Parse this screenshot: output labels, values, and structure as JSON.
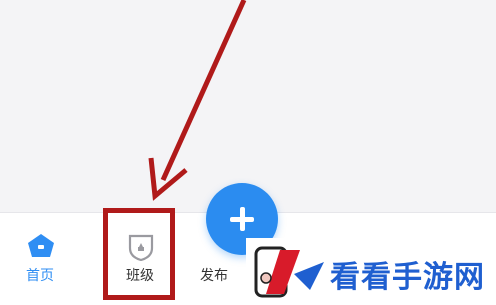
{
  "tabbar": {
    "items": [
      {
        "label": "首页",
        "icon": "home-icon",
        "active": true
      },
      {
        "label": "班级",
        "icon": "class-badge-icon",
        "active": false
      },
      {
        "label": "发布",
        "icon": "plus-icon",
        "active": false
      }
    ]
  },
  "annotation": {
    "arrow_color": "#b01a1a",
    "box_color": "#b01a1a"
  },
  "watermark": {
    "text": "看看手游网"
  },
  "colors": {
    "accent": "#2b8cf0",
    "active_tab": "#2f8ef3",
    "annotation": "#b01a1a"
  }
}
